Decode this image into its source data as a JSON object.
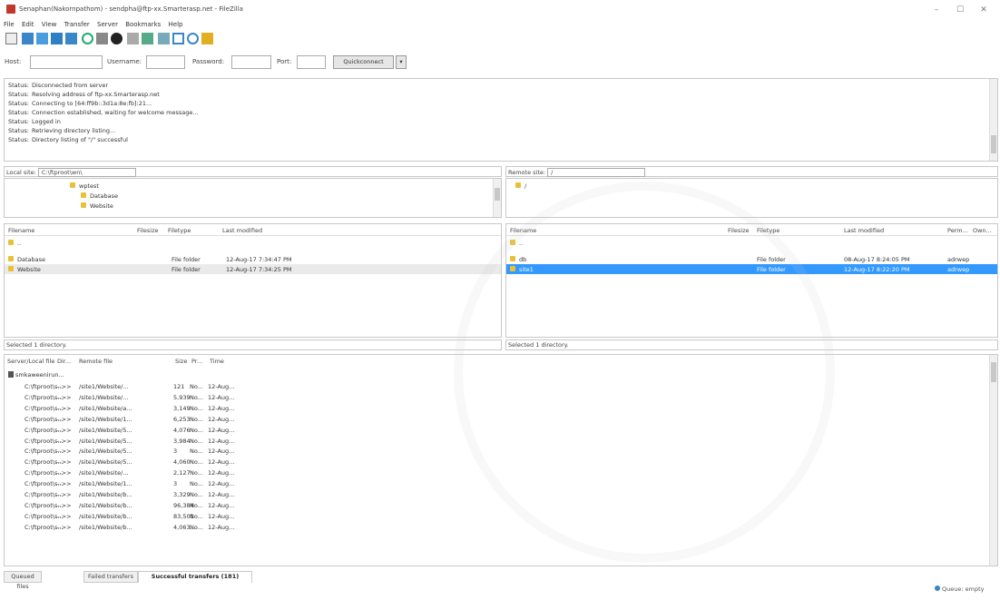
{
  "window": {
    "title": "Senaphan(Nakornpathom) - sendpha@ftp-xx.Smarterasp.net - FileZilla",
    "minimize": "–",
    "maximize": "☐",
    "close": "✕"
  },
  "menu": [
    "File",
    "Edit",
    "View",
    "Transfer",
    "Server",
    "Bookmarks",
    "Help"
  ],
  "quickconnect": {
    "host_label": "Host:",
    "user_label": "Username:",
    "pass_label": "Password:",
    "port_label": "Port:",
    "button": "Quickconnect",
    "dropdown": "▾"
  },
  "log": [
    {
      "k": "Status:",
      "v": "Disconnected from server"
    },
    {
      "k": "Status:",
      "v": "Resolving address of ftp-xx.Smarterasp.net"
    },
    {
      "k": "Status:",
      "v": "Connecting to [64:ff9b::3d1a:8e:fb]:21..."
    },
    {
      "k": "Status:",
      "v": "Connection established, waiting for welcome message..."
    },
    {
      "k": "Status:",
      "v": "Logged in"
    },
    {
      "k": "Status:",
      "v": "Retrieving directory listing..."
    },
    {
      "k": "Status:",
      "v": "Directory listing of \"/\" successful"
    }
  ],
  "local": {
    "site_label": "Local site:",
    "site_path": "C:\\ftproot\\wn\\",
    "tree": [
      "wptest",
      "Database",
      "Website"
    ],
    "headers": [
      "Filename",
      "Filesize",
      "Filetype",
      "Last modified"
    ],
    "rows": [
      {
        "name": "..",
        "size": "",
        "type": "",
        "modified": ""
      },
      {
        "name": "Database",
        "size": "",
        "type": "File folder",
        "modified": "12-Aug-17 7:34:47 PM"
      },
      {
        "name": "Website",
        "size": "",
        "type": "File folder",
        "modified": "12-Aug-17 7:34:25 PM"
      }
    ],
    "status": "Selected 1 directory."
  },
  "remote": {
    "site_label": "Remote site:",
    "site_path": "/",
    "tree": [
      "/"
    ],
    "headers": [
      "Filename",
      "Filesize",
      "Filetype",
      "Last modified",
      "Perm...",
      "Own..."
    ],
    "rows": [
      {
        "name": "..",
        "size": "",
        "type": "",
        "modified": "",
        "perm": "",
        "owner": ""
      },
      {
        "name": "db",
        "size": "",
        "type": "File folder",
        "modified": "08-Aug-17 8:24:05 PM",
        "perm": "adrwep",
        "owner": ""
      },
      {
        "name": "site1",
        "size": "",
        "type": "File folder",
        "modified": "12-Aug-17 8:22:20 PM",
        "perm": "adrwep",
        "owner": ""
      }
    ],
    "status": "Selected 1 directory."
  },
  "queue": {
    "headers": [
      "Server/Local file",
      "Dir...",
      "Remote file",
      "Size",
      "Pr...",
      "Time"
    ],
    "server": "smkaweenirun...",
    "rows": [
      {
        "local": "C:\\ftproot\\s...",
        "dir": "-->>",
        "remote": "/site1/Website/...",
        "size": "121",
        "pr": "No...",
        "time": "12-Aug..."
      },
      {
        "local": "C:\\ftproot\\s...",
        "dir": "-->>",
        "remote": "/site1/Website/...",
        "size": "5,939",
        "pr": "No...",
        "time": "12-Aug..."
      },
      {
        "local": "C:\\ftproot\\s...",
        "dir": "-->>",
        "remote": "/site1/Website/a...",
        "size": "3,149",
        "pr": "No...",
        "time": "12-Aug..."
      },
      {
        "local": "C:\\ftproot\\s...",
        "dir": "-->>",
        "remote": "/site1/Website/1...",
        "size": "6,253",
        "pr": "No...",
        "time": "12-Aug..."
      },
      {
        "local": "C:\\ftproot\\s...",
        "dir": "-->>",
        "remote": "/site1/Website/5...",
        "size": "4,076",
        "pr": "No...",
        "time": "12-Aug..."
      },
      {
        "local": "C:\\ftproot\\s...",
        "dir": "-->>",
        "remote": "/site1/Website/5...",
        "size": "3,984",
        "pr": "No...",
        "time": "12-Aug..."
      },
      {
        "local": "C:\\ftproot\\s...",
        "dir": "-->>",
        "remote": "/site1/Website/5...",
        "size": "3",
        "pr": "No...",
        "time": "12-Aug..."
      },
      {
        "local": "C:\\ftproot\\s...",
        "dir": "-->>",
        "remote": "/site1/Website/5...",
        "size": "4,060",
        "pr": "No...",
        "time": "12-Aug..."
      },
      {
        "local": "C:\\ftproot\\s...",
        "dir": "-->>",
        "remote": "/site1/Website/...",
        "size": "2,127",
        "pr": "No...",
        "time": "12-Aug..."
      },
      {
        "local": "C:\\ftproot\\s...",
        "dir": "-->>",
        "remote": "/site1/Website/1...",
        "size": "3",
        "pr": "No...",
        "time": "12-Aug..."
      },
      {
        "local": "C:\\ftproot\\s...",
        "dir": "-->>",
        "remote": "/site1/Website/b...",
        "size": "3,329",
        "pr": "No...",
        "time": "12-Aug..."
      },
      {
        "local": "C:\\ftproot\\s...",
        "dir": "-->>",
        "remote": "/site1/Website/b...",
        "size": "96,384",
        "pr": "No...",
        "time": "12-Aug..."
      },
      {
        "local": "C:\\ftproot\\s...",
        "dir": "-->>",
        "remote": "/site1/Website/b...",
        "size": "83,501",
        "pr": "No...",
        "time": "12-Aug..."
      },
      {
        "local": "C:\\ftproot\\s...",
        "dir": "-->>",
        "remote": "/site1/Website/b...",
        "size": "4,063...",
        "pr": "No...",
        "time": "12-Aug..."
      }
    ]
  },
  "tabs": [
    "Queued files",
    "Failed transfers",
    "Successful transfers (181)"
  ],
  "statusbar": {
    "queue": "Queue: empty"
  },
  "colors": {
    "selection": "#3399ff",
    "folder": "#e8c13a",
    "border": "#c8c8c8"
  }
}
